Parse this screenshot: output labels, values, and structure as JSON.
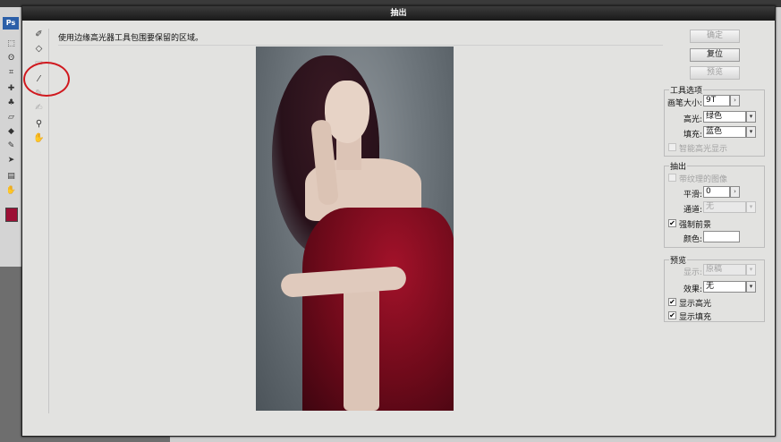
{
  "app": {
    "logo_text": "Ps"
  },
  "dialog": {
    "title": "抽出",
    "instruction": "使用边缘高光器工具包围要保留的区域。"
  },
  "buttons": {
    "ok": "确定",
    "reset": "复位",
    "preview": "预览"
  },
  "tool_options": {
    "title": "工具选项",
    "brush_size_label": "画笔大小:",
    "brush_size_value": "9T",
    "highlight_label": "高光:",
    "highlight_value": "绿色",
    "fill_label": "填充:",
    "fill_value": "蓝色",
    "smart_highlight_label": "智能高光显示"
  },
  "extraction": {
    "title": "抽出",
    "textured_label": "带纹理的图像",
    "smooth_label": "平滑:",
    "smooth_value": "0",
    "channel_label": "通道:",
    "channel_value": "无",
    "force_fg_label": "强制前景",
    "color_label": "颜色:"
  },
  "preview": {
    "title": "预览",
    "show_label": "显示:",
    "show_value": "原稿",
    "effect_label": "效果:",
    "effect_value": "无",
    "show_highlight_label": "显示高光",
    "show_fill_label": "显示填充"
  },
  "checkmark": "✔",
  "dropdown_arrow": "▾",
  "stepper_arrow": "›",
  "colors": {
    "foreground_swatch": "#9c1035",
    "annotation_circle": "#d0181e",
    "title_bar": "#1f1f1f"
  }
}
